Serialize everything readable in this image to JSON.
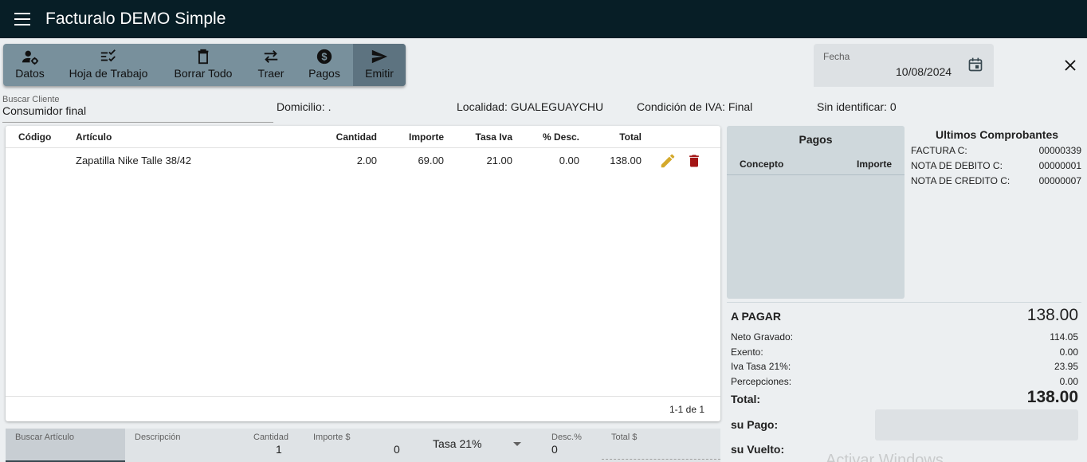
{
  "app": {
    "title": "Facturalo DEMO Simple"
  },
  "toolbar": {
    "datos": "Datos",
    "hoja": "Hoja de Trabajo",
    "borrar": "Borrar Todo",
    "traer": "Traer",
    "pagos": "Pagos",
    "emitir": "Emitir"
  },
  "fecha": {
    "label": "Fecha",
    "value": "10/08/2024"
  },
  "cliente": {
    "label": "Buscar Cliente",
    "value": "Consumidor final",
    "domicilio": "Domicilio: .",
    "localidad": "Localidad: GUALEGUAYCHU",
    "condicion": "Condición de IVA: Final",
    "sin_identificar": "Sin identificar: 0"
  },
  "table": {
    "headers": {
      "codigo": "Código",
      "articulo": "Artículo",
      "cantidad": "Cantidad",
      "importe": "Importe",
      "tasa": "Tasa Iva",
      "desc": "% Desc.",
      "total": "Total"
    },
    "rows": [
      {
        "codigo": "",
        "articulo": "Zapatilla Nike Talle 38/42",
        "cantidad": "2.00",
        "importe": "69.00",
        "tasa": "21.00",
        "desc": "0.00",
        "total": "138.00"
      }
    ],
    "pagination": "1-1 de 1"
  },
  "pagos": {
    "title": "Pagos",
    "concepto": "Concepto",
    "importe": "Importe"
  },
  "ultimos": {
    "title": "Ultimos Comprobantes",
    "items": [
      {
        "label": "FACTURA C:",
        "value": "00000339"
      },
      {
        "label": "NOTA DE DEBITO C:",
        "value": "00000001"
      },
      {
        "label": "NOTA DE CREDITO C:",
        "value": "00000007"
      }
    ]
  },
  "summary": {
    "a_pagar_label": "A PAGAR",
    "a_pagar_value": "138.00",
    "neto_label": "Neto Gravado:",
    "neto_value": "114.05",
    "exento_label": "Exento:",
    "exento_value": "0.00",
    "iva_label": "Iva Tasa 21%:",
    "iva_value": "23.95",
    "percep_label": "Percepciones:",
    "percep_value": "0.00",
    "total_label": "Total:",
    "total_value": "138.00",
    "su_pago": "su Pago:",
    "su_vuelto": "su Vuelto:"
  },
  "entry": {
    "buscar_articulo": "Buscar Artículo",
    "descripcion": "Descripción",
    "cantidad_label": "Cantidad",
    "cantidad_value": "1",
    "importe_label": "Importe $",
    "importe_value": "0",
    "tasa": "Tasa 21%",
    "desc_label": "Desc.%",
    "desc_value": "0",
    "total_label": "Total $"
  },
  "watermark": "Activar Windows",
  "colors": {
    "appbar": "#071e26",
    "toolbar": "#78909c",
    "edit": "#d4a92b",
    "delete": "#a31515"
  }
}
